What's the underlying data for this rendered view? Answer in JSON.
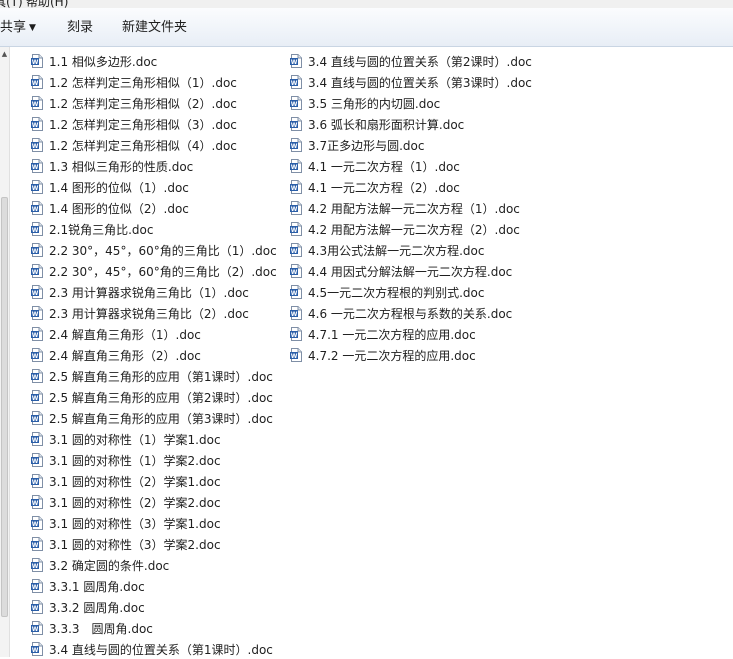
{
  "menubar": {
    "items": [
      "具(T)",
      "帮助(H)"
    ]
  },
  "toolbar": {
    "share_label": "共享",
    "burn_label": "刻录",
    "new_folder_label": "新建文件夹"
  },
  "files": {
    "column1": [
      "1.1  相似多边形.doc",
      "1.2 怎样判定三角形相似（1）.doc",
      "1.2 怎样判定三角形相似（2）.doc",
      "1.2 怎样判定三角形相似（3）.doc",
      "1.2 怎样判定三角形相似（4）.doc",
      "1.3 相似三角形的性质.doc",
      "1.4 图形的位似（1）.doc",
      "1.4 图形的位似（2）.doc",
      "2.1锐角三角比.doc",
      "2.2 30°，45°，60°角的三角比（1）.doc",
      "2.2 30°，45°，60°角的三角比（2）.doc",
      "2.3 用计算器求锐角三角比（1）.doc",
      "2.3 用计算器求锐角三角比（2）.doc",
      "2.4 解直角三角形（1）.doc",
      "2.4 解直角三角形（2）.doc",
      "2.5 解直角三角形的应用（第1课时）.doc",
      "2.5 解直角三角形的应用（第2课时）.doc",
      "2.5 解直角三角形的应用（第3课时）.doc",
      "3.1 圆的对称性（1）学案1.doc",
      "3.1 圆的对称性（1）学案2.doc",
      "3.1 圆的对称性（2）学案1.doc",
      "3.1 圆的对称性（2）学案2.doc",
      "3.1 圆的对称性（3）学案1.doc",
      "3.1 圆的对称性（3）学案2.doc",
      "3.2 确定圆的条件.doc",
      "3.3.1 圆周角.doc",
      "3.3.2 圆周角.doc",
      "3.3.3　圆周角.doc",
      "3.4 直线与圆的位置关系（第1课时）.doc"
    ],
    "column2": [
      "3.4 直线与圆的位置关系（第2课时）.doc",
      "3.4 直线与圆的位置关系（第3课时）.doc",
      "3.5 三角形的内切圆.doc",
      "3.6 弧长和扇形面积计算.doc",
      "3.7正多边形与圆.doc",
      "4.1 一元二次方程（1）.doc",
      "4.1 一元二次方程（2）.doc",
      "4.2 用配方法解一元二次方程（1）.doc",
      "4.2 用配方法解一元二次方程（2）.doc",
      "4.3用公式法解一元二次方程.doc",
      "4.4 用因式分解法解一元二次方程.doc",
      "4.5一元二次方程根的判别式.doc",
      "4.6 一元二次方程根与系数的关系.doc",
      "4.7.1  一元二次方程的应用.doc",
      "4.7.2 一元二次方程的应用.doc"
    ]
  },
  "colors": {
    "icon_blue": "#2a5ea8",
    "toolbar_top": "#fbfcfe",
    "toolbar_bottom": "#e8eef6"
  },
  "icons": {
    "file": "word-document-icon",
    "dropdown": "chevron-down-icon"
  }
}
